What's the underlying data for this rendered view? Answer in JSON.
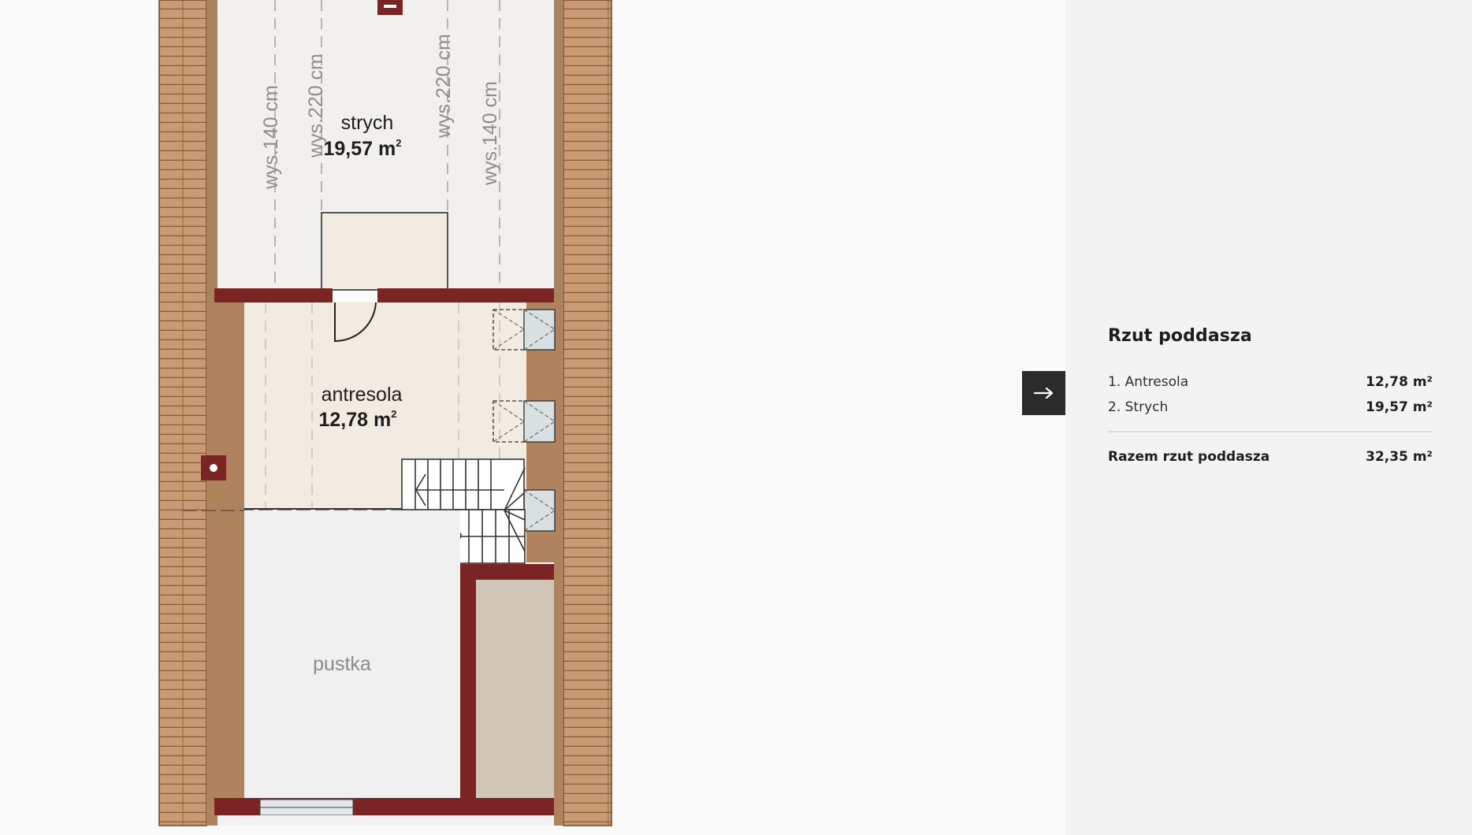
{
  "plan": {
    "rooms": [
      {
        "name": "strych",
        "area": "19,57 m",
        "sup": "2"
      },
      {
        "name": "antresola",
        "area": "12,78 m",
        "sup": "2"
      },
      {
        "name": "pustka"
      }
    ],
    "heights": [
      "wys.140 cm",
      "wys.220 cm",
      "wys.220 cm",
      "wys.140 cm"
    ]
  },
  "panel": {
    "title": "Rzut poddasza",
    "rooms": [
      {
        "label": "1. Antresola",
        "area": "12,78 m²"
      },
      {
        "label": "2. Strych",
        "area": "19,57 m²"
      }
    ],
    "total_label": "Razem rzut poddasza",
    "total_area": "32,35 m²"
  },
  "icons": {
    "toggle": "arrow-right-icon"
  },
  "colors": {
    "brick": "#c89a72",
    "wall": "#7a2424",
    "wood": "#b0835f",
    "floor_attic": "#f1f0ec",
    "floor_mezzanine": "#f1ebe2",
    "void": "#f0f0f0",
    "panel_bg": "#f3f3f3",
    "button_bg": "#2b2b2b"
  }
}
